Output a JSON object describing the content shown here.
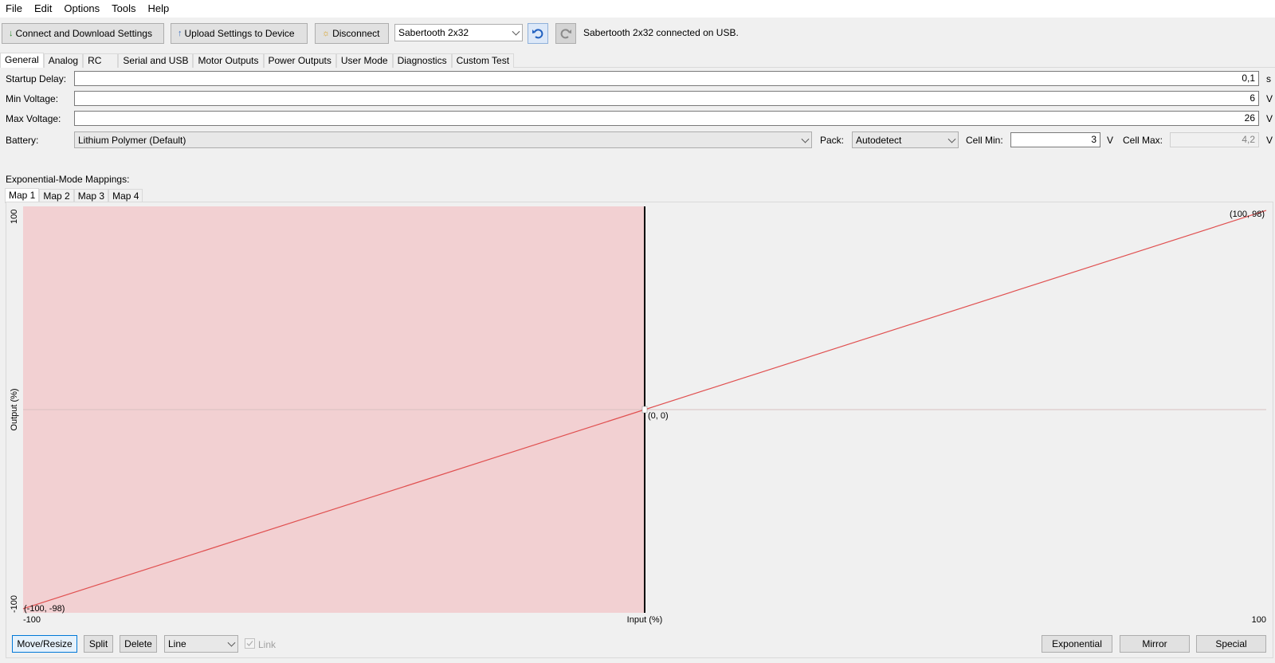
{
  "menu": [
    "File",
    "Edit",
    "Options",
    "Tools",
    "Help"
  ],
  "toolbar": {
    "connect_label": "Connect and Download Settings",
    "upload_label": "Upload Settings to Device",
    "disconnect_label": "Disconnect",
    "device_selected": "Sabertooth 2x32",
    "status": "Sabertooth 2x32 connected on USB."
  },
  "tabs": [
    "General",
    "Analog",
    "RC",
    "Serial and USB",
    "Motor Outputs",
    "Power Outputs",
    "User Mode",
    "Diagnostics",
    "Custom Test"
  ],
  "general": {
    "startup_delay": {
      "label": "Startup Delay:",
      "value": "0,1",
      "unit": "s"
    },
    "min_voltage": {
      "label": "Min Voltage:",
      "value": "6",
      "unit": "V"
    },
    "max_voltage": {
      "label": "Max Voltage:",
      "value": "26",
      "unit": "V"
    },
    "battery": {
      "label": "Battery:",
      "value": "Lithium Polymer (Default)",
      "pack_label": "Pack:",
      "pack_value": "Autodetect",
      "cell_min_label": "Cell Min:",
      "cell_min_value": "3",
      "cell_min_unit": "V",
      "cell_max_label": "Cell Max:",
      "cell_max_value": "4,2",
      "cell_max_unit": "V"
    }
  },
  "mappings": {
    "title": "Exponential-Mode Mappings:",
    "tabs": [
      "Map 1",
      "Map 2",
      "Map 3",
      "Map 4"
    ]
  },
  "chart_data": {
    "type": "line",
    "xlabel": "Input (%)",
    "ylabel": "Output (%)",
    "xlim": [
      -100,
      100
    ],
    "ylim": [
      -100,
      100
    ],
    "x_tick_labels": [
      "-100",
      "100"
    ],
    "y_tick_labels": [
      "-100",
      "100"
    ],
    "points": [
      {
        "x": -100,
        "y": -98,
        "label": "(-100, -98)"
      },
      {
        "x": 0,
        "y": 0,
        "label": "(0, 0)"
      },
      {
        "x": 100,
        "y": 98,
        "label": "(100, 98)"
      }
    ],
    "selected_region": [
      -100,
      0
    ],
    "colors": {
      "line": "#e05050",
      "selection": "#f2d0d2",
      "divider": "#000000"
    }
  },
  "bottom": {
    "move_resize": "Move/Resize",
    "split": "Split",
    "delete": "Delete",
    "curve_type": "Line",
    "link": "Link",
    "exponential": "Exponential",
    "mirror": "Mirror",
    "special": "Special"
  }
}
